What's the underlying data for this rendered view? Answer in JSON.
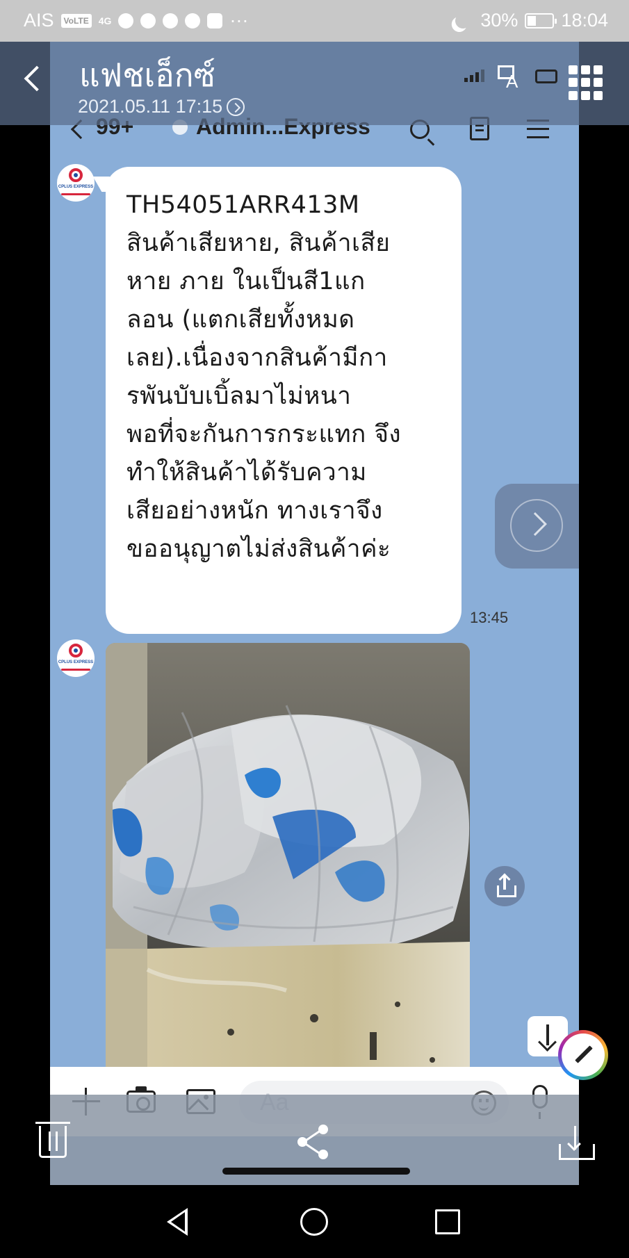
{
  "status_bar": {
    "carrier": "AIS",
    "volte": "VoLTE",
    "network": "4G",
    "battery_percent": "30%",
    "time": "18:04"
  },
  "gallery": {
    "title": "แฟชเอ็กซ์",
    "date": "2021.05.11 17:15",
    "icons": [
      "back-icon",
      "translate-icon",
      "grid-icon",
      "trash-icon",
      "share-icon",
      "download-icon",
      "edit-icon"
    ]
  },
  "chat": {
    "unread_count": "99+",
    "chat_name": "Admin...Express",
    "message_lines": [
      "TH54051ARR413M",
      "สินค้าเสียหาย, สินค้าเสีย",
      "หาย ภาย ในเป็นสี1แก",
      "ลอน (แตกเสียทั้งหมด",
      "เลย).เนื่องจากสินค้ามีกา",
      "รพันบับเบิ้ลมาไม่หนา",
      "พอที่จะกันการกระแทก จึง",
      "ทำให้สินค้าได้รับความ",
      "เสียอย่างหนัก ทางเราจึง",
      "ขออนุญาตไม่ส่งสินค้าค่ะ"
    ],
    "message_time": "13:45",
    "avatar_brand": "CPLUS EXPRESS",
    "input_placeholder": "Aa",
    "icons": [
      "search-icon",
      "notes-icon",
      "menu-icon",
      "plus-icon",
      "camera-icon",
      "image-icon",
      "emoji-icon",
      "mic-icon",
      "share-icon",
      "scroll-down-icon"
    ]
  },
  "colors": {
    "chat_background": "#8aaed8",
    "bubble": "#ffffff",
    "brand_red": "#d7263d",
    "brand_blue": "#1d4fa0"
  }
}
